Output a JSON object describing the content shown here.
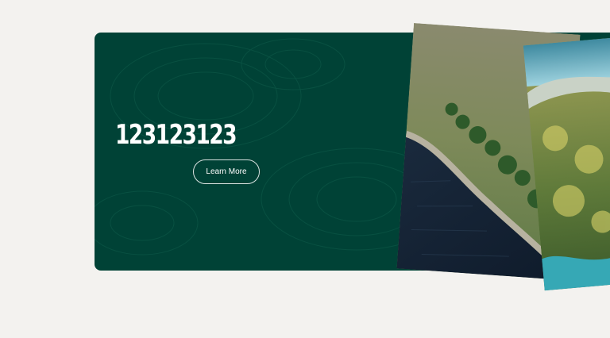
{
  "hero": {
    "title": "123123123",
    "cta_label": "Learn More"
  },
  "colors": {
    "page_background": "#f3f2ef",
    "card_background": "#004236",
    "text": "#ffffff"
  },
  "images": [
    {
      "name": "lake-shore-aerial-photo"
    },
    {
      "name": "forest-closeup-photo"
    }
  ]
}
